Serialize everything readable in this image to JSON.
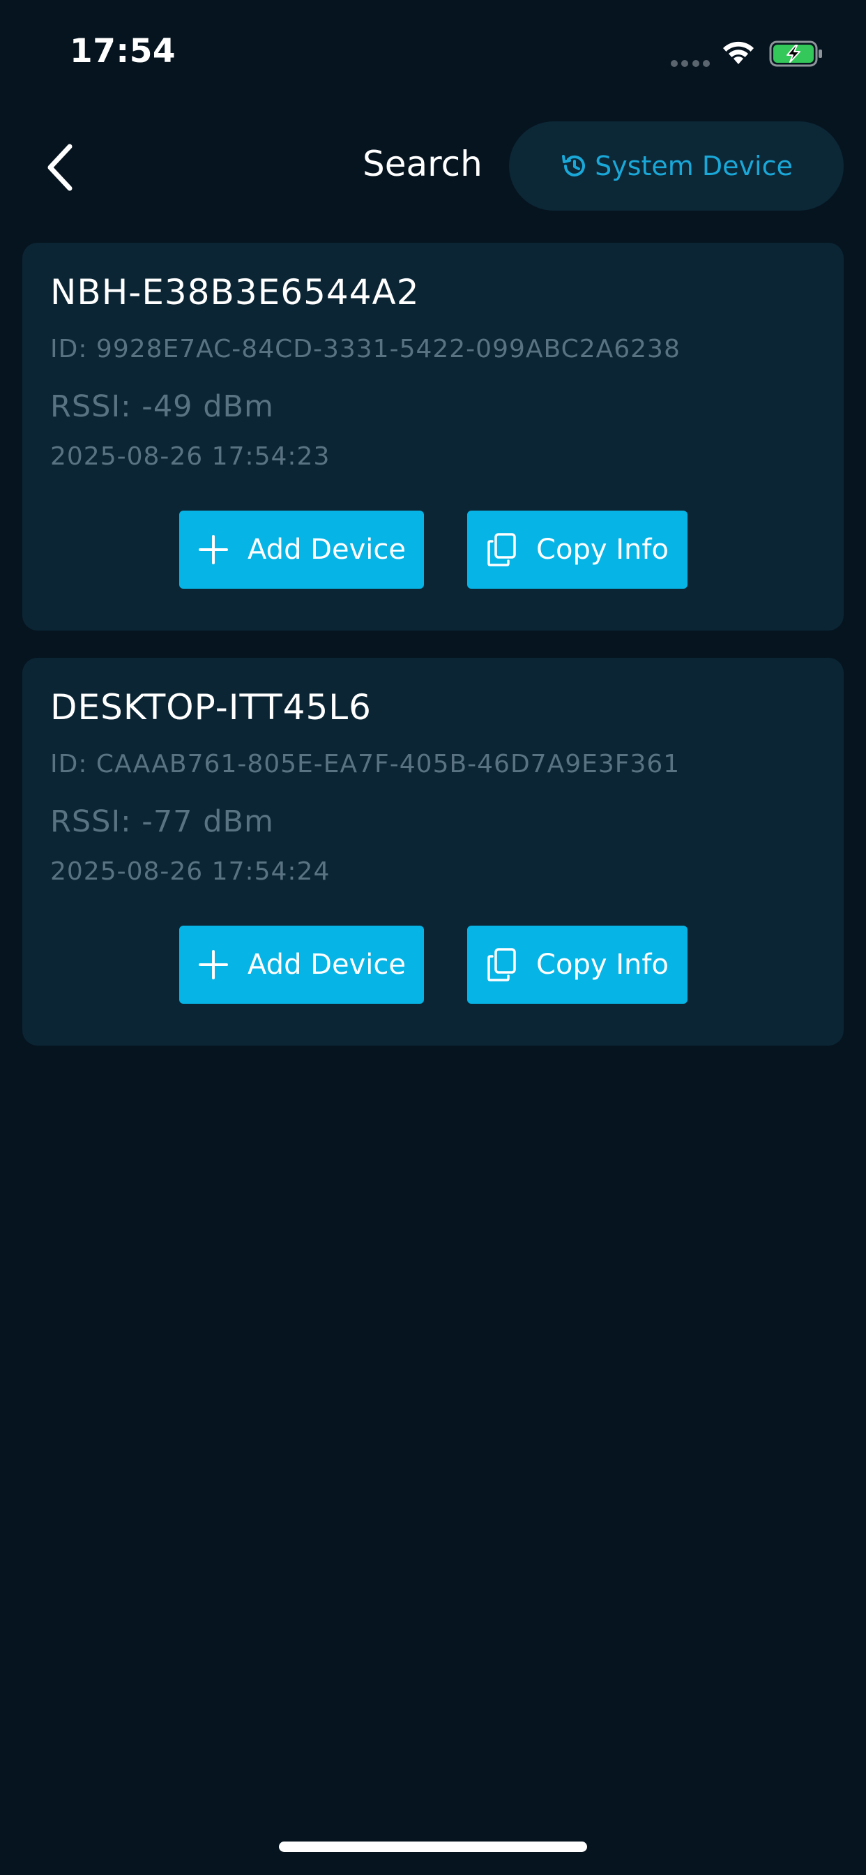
{
  "status_bar": {
    "time": "17:54",
    "icons": [
      "signal-dots-icon",
      "wifi-icon",
      "battery-charging-icon"
    ],
    "battery_color": "#34c759"
  },
  "nav": {
    "back_icon": "chevron-left-icon",
    "title": "Search",
    "system_device_label": "System Device",
    "system_device_icon": "history-icon"
  },
  "colors": {
    "background": "#06141f",
    "card": "#0b2534",
    "accent": "#06b4e6",
    "secondary_text": "#5a7383"
  },
  "devices": [
    {
      "name": "NBH-E38B3E6544A2",
      "id": "ID: 9928E7AC-84CD-3331-5422-099ABC2A6238",
      "rssi": "RSSI: -49 dBm",
      "time": "2025-08-26 17:54:23",
      "add_label": "Add Device",
      "copy_label": "Copy Info"
    },
    {
      "name": "DESKTOP-ITT45L6",
      "id": "ID: CAAAB761-805E-EA7F-405B-46D7A9E3F361",
      "rssi": "RSSI: -77 dBm",
      "time": "2025-08-26 17:54:24",
      "add_label": "Add Device",
      "copy_label": "Copy Info"
    }
  ]
}
